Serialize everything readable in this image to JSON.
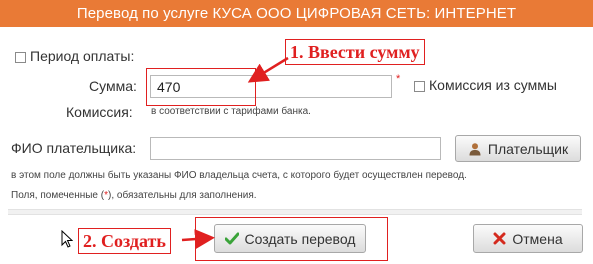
{
  "header": {
    "title": "Перевод по услуге КУСА ООО ЦИФРОВАЯ СЕТЬ: ИНТЕРНЕТ"
  },
  "form": {
    "period_label": "Период оплаты:",
    "amount_label": "Сумма:",
    "amount_value": "470",
    "required_mark": "*",
    "commission_from_amount_label": "Комиссия из суммы",
    "commission_label": "Комиссия:",
    "commission_note": "в соответствии с тарифами банка.",
    "payer_name_label": "ФИО плательщика:",
    "payer_name_value": "",
    "payer_button_label": "Плательщик",
    "payer_note": "в этом поле должны быть указаны ФИО владельца счета, с которого будет осуществлен перевод.",
    "required_note_before": "Поля, помеченные (",
    "required_note_mark": "*",
    "required_note_after": "), обязательны для заполнения."
  },
  "actions": {
    "create_label": "Создать перевод",
    "cancel_label": "Отмена"
  },
  "annotations": {
    "step1": "1. Ввести сумму",
    "step2": "2. Создать"
  },
  "colors": {
    "header_bg": "#e97a36",
    "annotation_red": "#e02020",
    "ok_green": "#3aa339",
    "cancel_red": "#d42a1e"
  },
  "icons": {
    "payer_button": "person-icon",
    "create_button": "checkmark-icon",
    "cancel_button": "x-icon",
    "cursor": "mouse-pointer-icon"
  }
}
